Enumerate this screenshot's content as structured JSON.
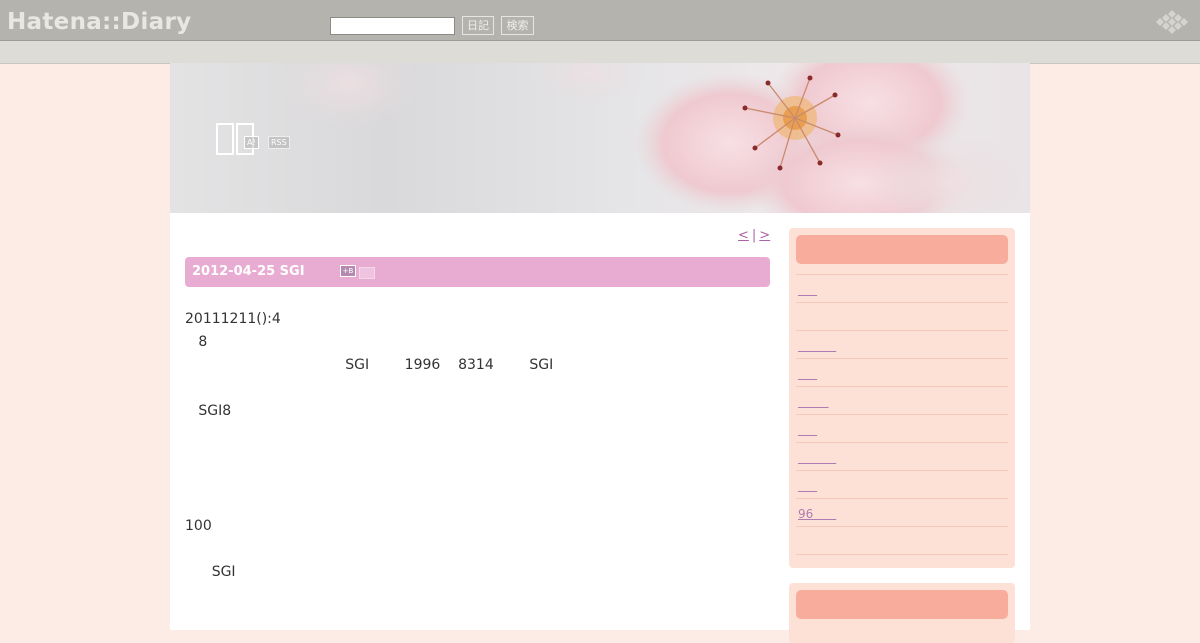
{
  "topbar": {
    "logo": "Hatena::Diary",
    "search_placeholder": "",
    "diary_button": "日記",
    "search_button": "検索"
  },
  "banner": {
    "antenna_badge": "A!",
    "rss_badge": "RSS"
  },
  "pager": {
    "prev": "<",
    "separator": "|",
    "next": ">"
  },
  "entry": {
    "title": "2012-04-25 SGI",
    "bookmark_icon": "+B",
    "lines": [
      "20111211():4",
      "   8",
      "                                    SGI        1996    8314        SGI",
      "   SGI8",
      "100",
      "      SGI"
    ]
  },
  "sidebar": {
    "links": [
      "     ",
      "",
      "          ",
      "     ",
      "        ",
      "     ",
      "          ",
      "     ",
      "96      ",
      ""
    ]
  },
  "colors": {
    "page_bg": "#fdebe6",
    "accent": "#e8acd2",
    "sidebar_bg": "#fde1d7",
    "sidebar_heading": "#f8ad9c",
    "link": "#aa62a8"
  }
}
